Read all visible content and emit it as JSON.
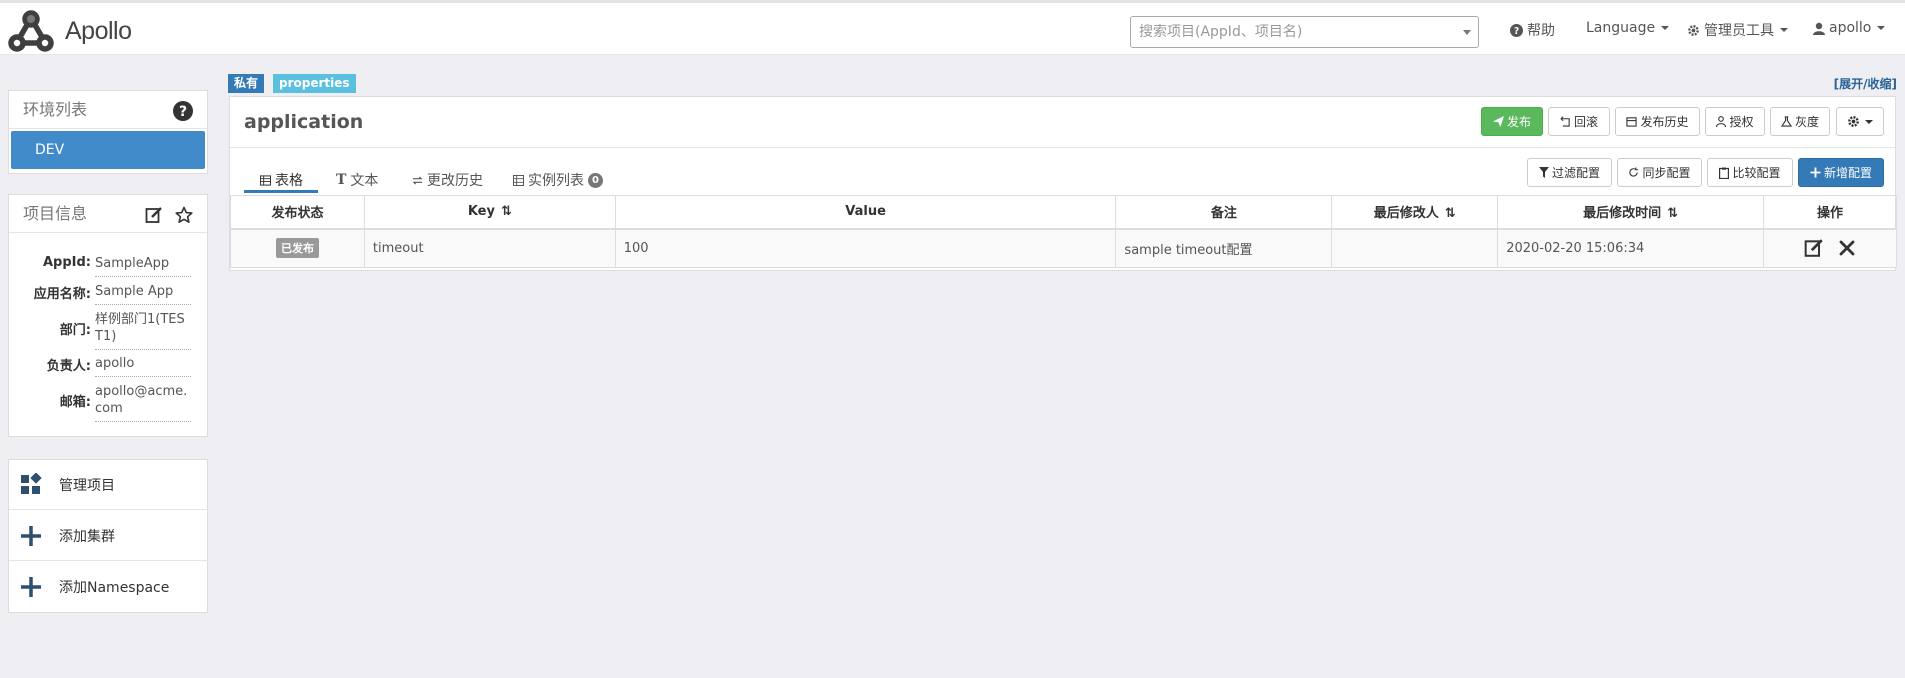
{
  "brand": {
    "name": "Apollo"
  },
  "search": {
    "placeholder": "搜索项目(AppId、项目名)"
  },
  "nav": {
    "help": "帮助",
    "language": "Language",
    "admin_tools": "管理员工具",
    "user": "apollo"
  },
  "env_panel": {
    "title": "环境列表",
    "items": [
      {
        "label": "DEV"
      }
    ]
  },
  "project_info": {
    "title": "项目信息",
    "fields": [
      {
        "label": "AppId:",
        "value": "SampleApp"
      },
      {
        "label": "应用名称:",
        "value": "Sample App"
      },
      {
        "label": "部门:",
        "value": "样例部门1(TEST1)"
      },
      {
        "label": "负责人:",
        "value": "apollo"
      },
      {
        "label": "邮箱:",
        "value": "apollo@acme.com"
      }
    ]
  },
  "actions": [
    {
      "label": "管理项目",
      "icon": "dashboard-icon"
    },
    {
      "label": "添加集群",
      "icon": "plus-icon"
    },
    {
      "label": "添加Namespace",
      "icon": "plus-icon"
    }
  ],
  "namespace": {
    "tags": {
      "scope": "私有",
      "format": "properties"
    },
    "toggle": "[展开/收缩]",
    "name": "application",
    "buttons": {
      "publish": "发布",
      "rollback": "回滚",
      "history": "发布历史",
      "grant": "授权",
      "gray": "灰度"
    },
    "tabs": [
      {
        "label": "表格",
        "icon": "table-icon"
      },
      {
        "label": "文本",
        "icon": "text-icon"
      },
      {
        "label": "更改历史",
        "icon": "history-icon"
      },
      {
        "label": "实例列表",
        "icon": "instance-icon",
        "badge": "0"
      }
    ],
    "table_buttons": {
      "filter": "过滤配置",
      "sync": "同步配置",
      "diff": "比较配置",
      "add": "新增配置"
    },
    "columns": [
      "发布状态",
      "Key",
      "Value",
      "备注",
      "最后修改人",
      "最后修改时间",
      "操作"
    ],
    "rows": [
      {
        "status": "已发布",
        "key": "timeout",
        "value": "100",
        "comment": "sample timeout配置",
        "modifier": "",
        "modified_time": "2020-02-20 15:06:34"
      }
    ]
  },
  "colors": {
    "primary": "#337ab7",
    "success": "#5cb85c",
    "env_active": "#428bca",
    "tag_info": "#5bc0de"
  }
}
